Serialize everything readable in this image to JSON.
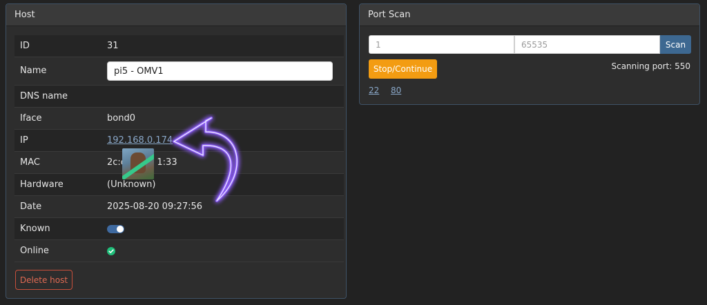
{
  "host": {
    "title": "Host",
    "rows": {
      "id": {
        "label": "ID",
        "value": "31"
      },
      "name": {
        "label": "Name",
        "value": "pi5 - OMV1"
      },
      "dns": {
        "label": "DNS name",
        "value": ""
      },
      "iface": {
        "label": "Iface",
        "value": "bond0"
      },
      "ip": {
        "label": "IP",
        "value": "192.168.0.174"
      },
      "mac": {
        "label": "MAC",
        "value": "2c:c           1:33"
      },
      "hardware": {
        "label": "Hardware",
        "value": "(Unknown)"
      },
      "date": {
        "label": "Date",
        "value": "2025-08-20 09:27:56"
      },
      "known": {
        "label": "Known",
        "value": true
      },
      "online": {
        "label": "Online",
        "value": true
      }
    },
    "delete_label": "Delete host"
  },
  "port_scan": {
    "title": "Port Scan",
    "from_value": "1",
    "to_value": "65535",
    "scan_label": "Scan",
    "stop_label": "Stop/Continue",
    "status": "Scanning port: 550",
    "open_ports": [
      "22",
      "80"
    ]
  },
  "colors": {
    "accent": "#3d6891",
    "warning": "#f39c12",
    "danger": "#e06a53",
    "success": "#1fbf7a",
    "link": "#8aa8c9",
    "arrow_glow": "#8b5cf6"
  }
}
